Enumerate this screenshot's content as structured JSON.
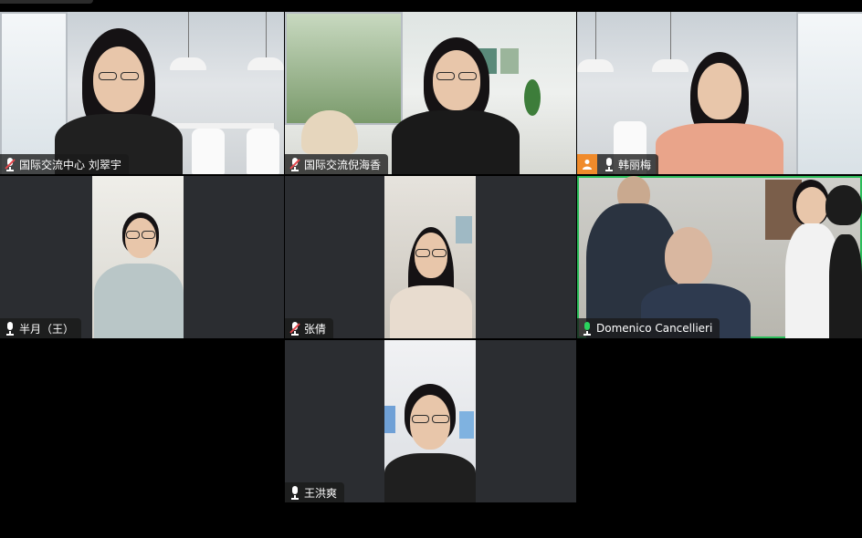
{
  "window": {
    "title": ""
  },
  "participants": [
    {
      "name": "国际交流中心 刘翠宇",
      "mic": "muted",
      "avatar": false
    },
    {
      "name": "国际交流倪海香",
      "mic": "muted",
      "avatar": false
    },
    {
      "name": "韩丽梅",
      "mic": "on",
      "avatar": true
    },
    {
      "name": "半月（王）",
      "mic": "on",
      "avatar": false
    },
    {
      "name": "张倩",
      "mic": "muted",
      "avatar": false
    },
    {
      "name": "Domenico Cancellieri",
      "mic": "speaking",
      "avatar": false,
      "active_speaker": true
    },
    {
      "name": "王洪爽",
      "mic": "on",
      "avatar": false
    }
  ],
  "colors": {
    "background": "#000000",
    "tile_background": "#2b2d31",
    "active_speaker_border": "#2bbd5a",
    "muted_indicator": "#e5484d",
    "avatar_badge": "#f08b2b"
  },
  "icons": {
    "mic": "microphone-icon",
    "mic_muted": "microphone-muted-icon",
    "avatar": "person-avatar-icon"
  }
}
